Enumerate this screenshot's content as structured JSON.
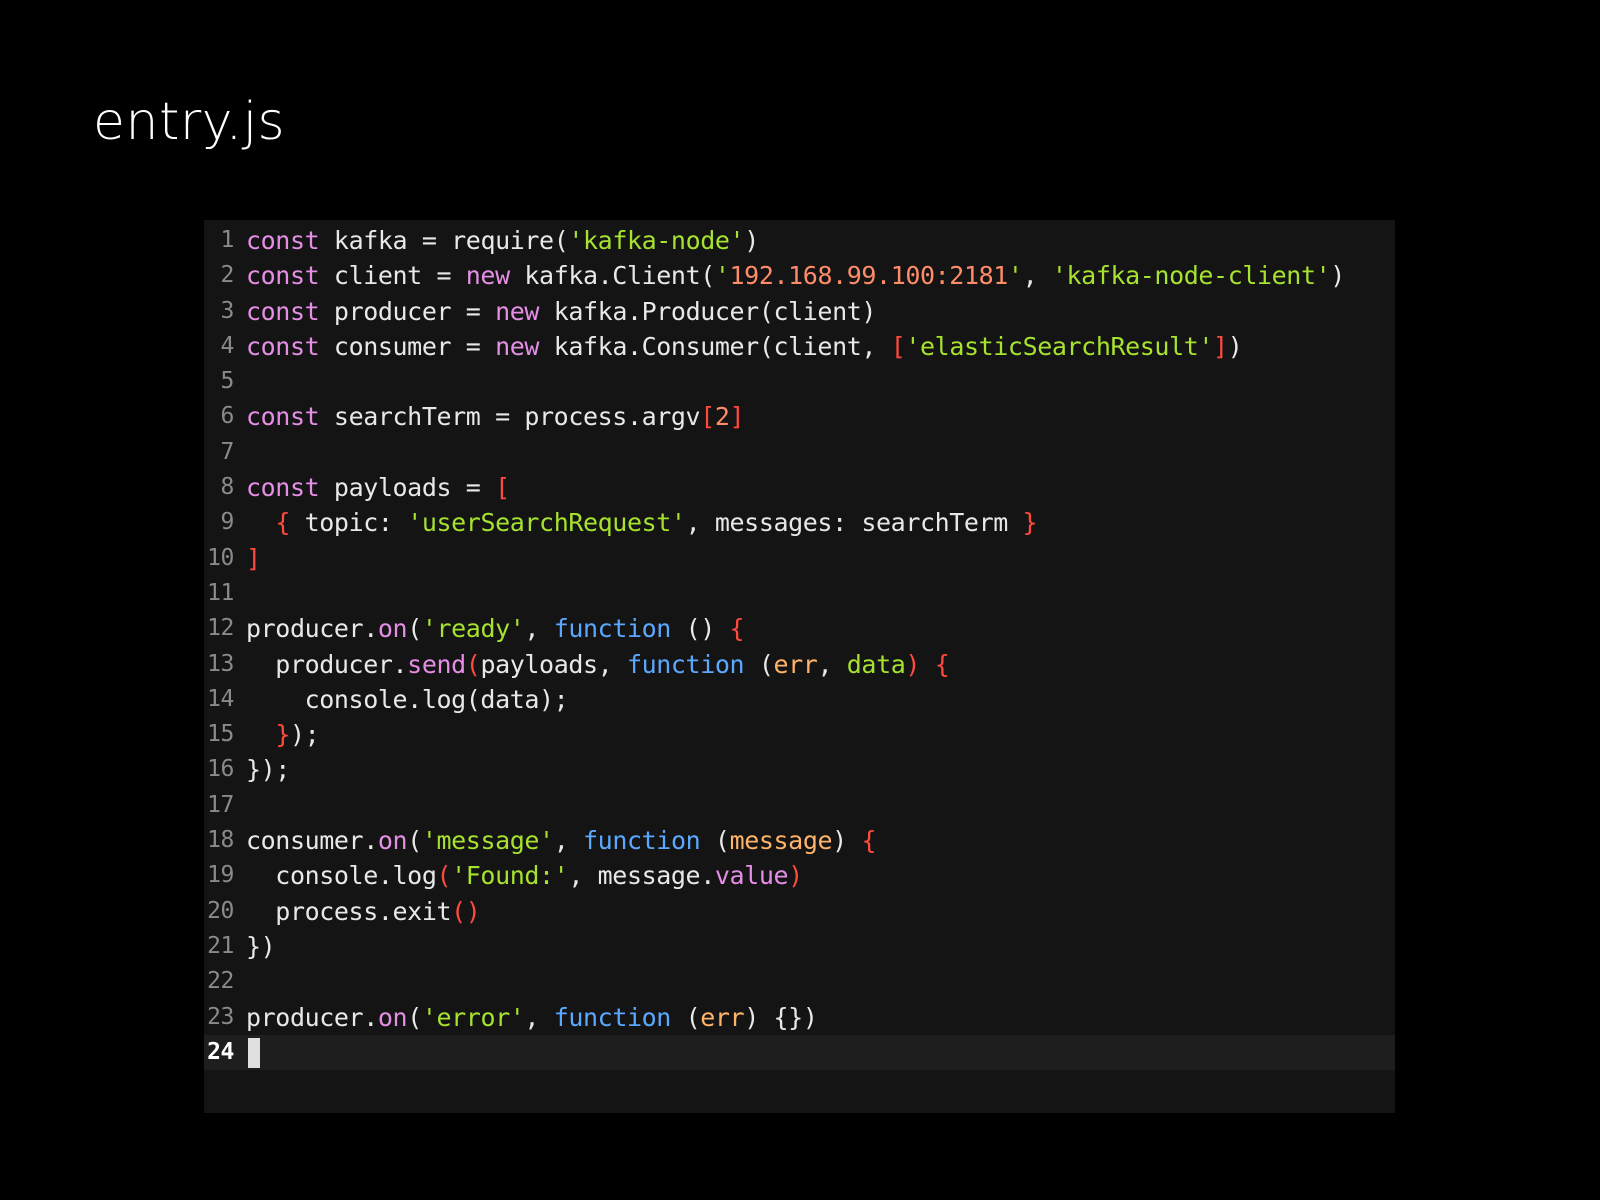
{
  "slide": {
    "title": "entry.js"
  },
  "colors": {
    "background": "#000000",
    "editor_background": "#141414",
    "current_line": "#1e1e1e",
    "keyword": "#e58ee5",
    "function_keyword": "#5aa8ff",
    "string": "#a6e22e",
    "number": "#ff8c69",
    "bracket": "#ff4a3d",
    "method": "#e58ee5",
    "parameter": "#ffb46a",
    "plain": "#e8e8e8",
    "line_number": "#8a8a8a"
  },
  "editor": {
    "current_line_number": "24",
    "lines": [
      {
        "num": "1",
        "tokens": [
          {
            "t": "const",
            "c": "keyword"
          },
          {
            "t": " kafka = ",
            "c": "plain"
          },
          {
            "t": "require",
            "c": "plain"
          },
          {
            "t": "(",
            "c": "plain"
          },
          {
            "t": "'kafka-node'",
            "c": "string"
          },
          {
            "t": ")",
            "c": "plain"
          }
        ]
      },
      {
        "num": "2",
        "tokens": [
          {
            "t": "const",
            "c": "keyword"
          },
          {
            "t": " client = ",
            "c": "plain"
          },
          {
            "t": "new",
            "c": "keyword"
          },
          {
            "t": " kafka.Client(",
            "c": "plain"
          },
          {
            "t": "'",
            "c": "string"
          },
          {
            "t": "192.168.99.100:2181",
            "c": "number"
          },
          {
            "t": "'",
            "c": "string"
          },
          {
            "t": ", ",
            "c": "plain"
          },
          {
            "t": "'kafka-node-client'",
            "c": "string"
          },
          {
            "t": ")",
            "c": "plain"
          }
        ]
      },
      {
        "num": "3",
        "tokens": [
          {
            "t": "const",
            "c": "keyword"
          },
          {
            "t": " producer = ",
            "c": "plain"
          },
          {
            "t": "new",
            "c": "keyword"
          },
          {
            "t": " kafka.Producer(client)",
            "c": "plain"
          }
        ]
      },
      {
        "num": "4",
        "tokens": [
          {
            "t": "const",
            "c": "keyword"
          },
          {
            "t": " consumer = ",
            "c": "plain"
          },
          {
            "t": "new",
            "c": "keyword"
          },
          {
            "t": " kafka.Consumer(client, ",
            "c": "plain"
          },
          {
            "t": "[",
            "c": "bracket"
          },
          {
            "t": "'elasticSearchResult'",
            "c": "string"
          },
          {
            "t": "]",
            "c": "bracket"
          },
          {
            "t": ")",
            "c": "plain"
          }
        ]
      },
      {
        "num": "5",
        "tokens": []
      },
      {
        "num": "6",
        "tokens": [
          {
            "t": "const",
            "c": "keyword"
          },
          {
            "t": " searchTerm = process.argv",
            "c": "plain"
          },
          {
            "t": "[",
            "c": "bracket"
          },
          {
            "t": "2",
            "c": "number"
          },
          {
            "t": "]",
            "c": "bracket"
          }
        ]
      },
      {
        "num": "7",
        "tokens": []
      },
      {
        "num": "8",
        "tokens": [
          {
            "t": "const",
            "c": "keyword"
          },
          {
            "t": " payloads = ",
            "c": "plain"
          },
          {
            "t": "[",
            "c": "bracket"
          }
        ]
      },
      {
        "num": "9",
        "tokens": [
          {
            "t": "  ",
            "c": "plain"
          },
          {
            "t": "{",
            "c": "bracket"
          },
          {
            "t": " topic: ",
            "c": "plain"
          },
          {
            "t": "'userSearchRequest'",
            "c": "string"
          },
          {
            "t": ", messages: searchTerm ",
            "c": "plain"
          },
          {
            "t": "}",
            "c": "bracket"
          }
        ]
      },
      {
        "num": "10",
        "tokens": [
          {
            "t": "]",
            "c": "bracket"
          }
        ]
      },
      {
        "num": "11",
        "tokens": []
      },
      {
        "num": "12",
        "tokens": [
          {
            "t": "producer.",
            "c": "plain"
          },
          {
            "t": "on",
            "c": "method"
          },
          {
            "t": "(",
            "c": "plain"
          },
          {
            "t": "'ready'",
            "c": "string"
          },
          {
            "t": ", ",
            "c": "plain"
          },
          {
            "t": "function",
            "c": "function_keyword"
          },
          {
            "t": " () ",
            "c": "plain"
          },
          {
            "t": "{",
            "c": "bracket"
          }
        ]
      },
      {
        "num": "13",
        "tokens": [
          {
            "t": "  producer.",
            "c": "plain"
          },
          {
            "t": "send",
            "c": "method"
          },
          {
            "t": "(",
            "c": "bracket"
          },
          {
            "t": "payloads, ",
            "c": "plain"
          },
          {
            "t": "function",
            "c": "function_keyword"
          },
          {
            "t": " (",
            "c": "plain"
          },
          {
            "t": "err",
            "c": "parameter"
          },
          {
            "t": ", ",
            "c": "plain"
          },
          {
            "t": "data",
            "c": "string"
          },
          {
            "t": ") ",
            "c": "bracket"
          },
          {
            "t": "{",
            "c": "bracket"
          }
        ]
      },
      {
        "num": "14",
        "tokens": [
          {
            "t": "    console.log(data);",
            "c": "plain"
          }
        ]
      },
      {
        "num": "15",
        "tokens": [
          {
            "t": "  ",
            "c": "plain"
          },
          {
            "t": "}",
            "c": "bracket"
          },
          {
            "t": ");",
            "c": "plain"
          }
        ]
      },
      {
        "num": "16",
        "tokens": [
          {
            "t": "});",
            "c": "plain"
          }
        ]
      },
      {
        "num": "17",
        "tokens": []
      },
      {
        "num": "18",
        "tokens": [
          {
            "t": "consumer.",
            "c": "plain"
          },
          {
            "t": "on",
            "c": "method"
          },
          {
            "t": "(",
            "c": "plain"
          },
          {
            "t": "'message'",
            "c": "string"
          },
          {
            "t": ", ",
            "c": "plain"
          },
          {
            "t": "function",
            "c": "function_keyword"
          },
          {
            "t": " (",
            "c": "plain"
          },
          {
            "t": "message",
            "c": "parameter"
          },
          {
            "t": ") ",
            "c": "plain"
          },
          {
            "t": "{",
            "c": "bracket"
          }
        ]
      },
      {
        "num": "19",
        "tokens": [
          {
            "t": "  console.log",
            "c": "plain"
          },
          {
            "t": "(",
            "c": "bracket"
          },
          {
            "t": "'Found:'",
            "c": "string"
          },
          {
            "t": ", message.",
            "c": "plain"
          },
          {
            "t": "value",
            "c": "method"
          },
          {
            "t": ")",
            "c": "bracket"
          }
        ]
      },
      {
        "num": "20",
        "tokens": [
          {
            "t": "  process.exit",
            "c": "plain"
          },
          {
            "t": "()",
            "c": "bracket"
          }
        ]
      },
      {
        "num": "21",
        "tokens": [
          {
            "t": "})",
            "c": "plain"
          }
        ]
      },
      {
        "num": "22",
        "tokens": []
      },
      {
        "num": "23",
        "tokens": [
          {
            "t": "producer.",
            "c": "plain"
          },
          {
            "t": "on",
            "c": "method"
          },
          {
            "t": "(",
            "c": "plain"
          },
          {
            "t": "'error'",
            "c": "string"
          },
          {
            "t": ", ",
            "c": "plain"
          },
          {
            "t": "function",
            "c": "function_keyword"
          },
          {
            "t": " (",
            "c": "plain"
          },
          {
            "t": "err",
            "c": "parameter"
          },
          {
            "t": ") {})",
            "c": "plain"
          }
        ]
      },
      {
        "num": "24",
        "tokens": []
      }
    ]
  }
}
